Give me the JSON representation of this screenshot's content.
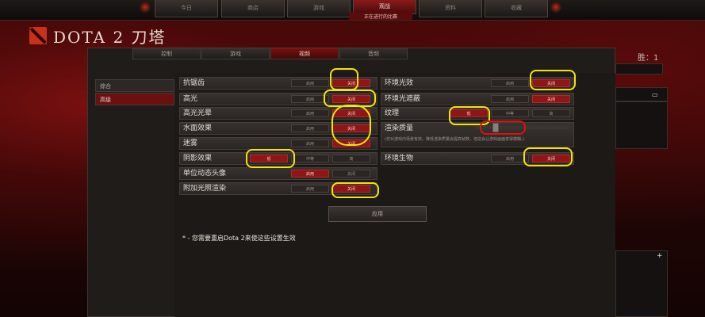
{
  "app": {
    "logo_text": "DOTA 2 刀塔"
  },
  "topnav": {
    "tabs": [
      "今日",
      "商店",
      "游戏",
      "观战",
      "资料",
      "收藏"
    ],
    "active_index": 3,
    "active_sub": "正在进行的比赛"
  },
  "settings_tabs": [
    "控制",
    "游戏",
    "视频",
    "音频"
  ],
  "settings_active_tab": "视频",
  "sidebar": [
    "综合",
    "高级"
  ],
  "sidebar_active": "高级",
  "options": {
    "on": "启用",
    "off": "关闭",
    "low": "低",
    "medium": "中等",
    "high": "高"
  },
  "left_settings": [
    {
      "label": "抗锯齿",
      "selected": "关闭"
    },
    {
      "label": "高光",
      "selected": "关闭"
    },
    {
      "label": "高光光晕",
      "selected": "关闭"
    },
    {
      "label": "水面效果",
      "selected": "关闭"
    },
    {
      "label": "迷雾",
      "selected": "关闭"
    },
    {
      "label": "阴影效果",
      "selected": "低"
    },
    {
      "label": "单位动态头像",
      "selected": "启用"
    },
    {
      "label": "附加光照渲染",
      "selected": "关闭"
    }
  ],
  "right_settings": [
    {
      "label": "环境光效",
      "selected": "关闭"
    },
    {
      "label": "环境光遮蔽",
      "selected": "关闭"
    },
    {
      "label": "纹理",
      "selected": "低"
    },
    {
      "label": "渲染质量",
      "selected": null
    },
    {
      "label": "环境生物",
      "selected": "关闭"
    }
  ],
  "render_quality_hint": "(仅对游戏内场景有效。降低渲染质量会提高帧数，但这会让游戏画面变得模糊。)",
  "render_quality_level": 0.18,
  "apply_label": "应用",
  "restart_note": "* - 您需要重启Dota 2来使这些设置生效",
  "wins_label": "胜：1",
  "colors": {
    "accent_red": "#8e1616",
    "highlight_yellow": "#f2e600",
    "highlight_red": "#e01010"
  }
}
